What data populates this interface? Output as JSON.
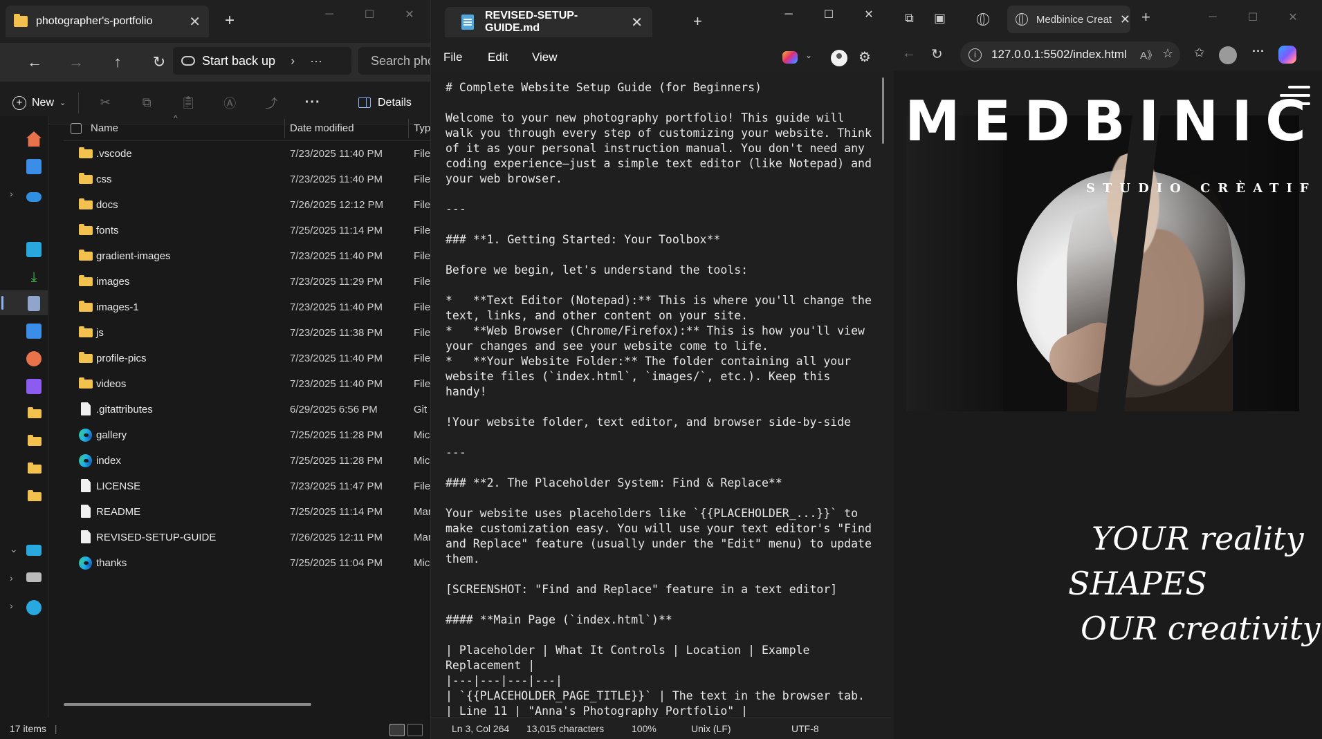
{
  "explorer": {
    "tab_title": "photographer's-portfolio",
    "address": "Start back up",
    "search_placeholder": "Search pho",
    "new_label": "New",
    "details_label": "Details",
    "columns": {
      "name": "Name",
      "date": "Date modified",
      "type": "Typ"
    },
    "rows": [
      {
        "name": ".vscode",
        "date": "7/23/2025 11:40 PM",
        "type": "File",
        "icon": "folder"
      },
      {
        "name": "css",
        "date": "7/23/2025 11:40 PM",
        "type": "File",
        "icon": "folder"
      },
      {
        "name": "docs",
        "date": "7/26/2025 12:12 PM",
        "type": "File",
        "icon": "folder"
      },
      {
        "name": "fonts",
        "date": "7/25/2025 11:14 PM",
        "type": "File",
        "icon": "folder"
      },
      {
        "name": "gradient-images",
        "date": "7/23/2025 11:40 PM",
        "type": "File",
        "icon": "folder"
      },
      {
        "name": "images",
        "date": "7/23/2025 11:29 PM",
        "type": "File",
        "icon": "folder"
      },
      {
        "name": "images-1",
        "date": "7/23/2025 11:40 PM",
        "type": "File",
        "icon": "folder"
      },
      {
        "name": "js",
        "date": "7/23/2025 11:38 PM",
        "type": "File",
        "icon": "folder"
      },
      {
        "name": "profile-pics",
        "date": "7/23/2025 11:40 PM",
        "type": "File",
        "icon": "folder"
      },
      {
        "name": "videos",
        "date": "7/23/2025 11:40 PM",
        "type": "File",
        "icon": "folder"
      },
      {
        "name": ".gitattributes",
        "date": "6/29/2025 6:56 PM",
        "type": "Git",
        "icon": "document"
      },
      {
        "name": "gallery",
        "date": "7/25/2025 11:28 PM",
        "type": "Mic",
        "icon": "edge"
      },
      {
        "name": "index",
        "date": "7/25/2025 11:28 PM",
        "type": "Mic",
        "icon": "edge"
      },
      {
        "name": "LICENSE",
        "date": "7/23/2025 11:47 PM",
        "type": "File",
        "icon": "document"
      },
      {
        "name": "README",
        "date": "7/25/2025 11:14 PM",
        "type": "Mar",
        "icon": "document"
      },
      {
        "name": "REVISED-SETUP-GUIDE",
        "date": "7/26/2025 12:11 PM",
        "type": "Mar",
        "icon": "document"
      },
      {
        "name": "thanks",
        "date": "7/25/2025 11:04 PM",
        "type": "Mic",
        "icon": "edge"
      }
    ],
    "status": "17 items",
    "status_sep": "|"
  },
  "notepad": {
    "tab_title": "REVISED-SETUP-GUIDE.md",
    "menu": [
      "File",
      "Edit",
      "View"
    ],
    "content": "# Complete Website Setup Guide (for Beginners)\n\nWelcome to your new photography portfolio! This guide will\nwalk you through every step of customizing your website. Think\nof it as your personal instruction manual. You don't need any\ncoding experience—just a simple text editor (like Notepad) and\nyour web browser.\n\n---\n\n### **1. Getting Started: Your Toolbox**\n\nBefore we begin, let's understand the tools:\n\n*   **Text Editor (Notepad):** This is where you'll change the\ntext, links, and other content on your site.\n*   **Web Browser (Chrome/Firefox):** This is how you'll view\nyour changes and see your website come to life.\n*   **Your Website Folder:** The folder containing all your\nwebsite files (`index.html`, `images/`, etc.). Keep this\nhandy!\n\n!Your website folder, text editor, and browser side-by-side\n\n---\n\n### **2. The Placeholder System: Find & Replace**\n\nYour website uses placeholders like `{{PLACEHOLDER_...}}` to\nmake customization easy. You will use your text editor's \"Find\nand Replace\" feature (usually under the \"Edit\" menu) to update\nthem.\n\n[SCREENSHOT: \"Find and Replace\" feature in a text editor]\n\n#### **Main Page (`index.html`)**\n\n| Placeholder | What It Controls | Location | Example\nReplacement |\n|---|---|---|---|\n| `{{PLACEHOLDER_PAGE_TITLE}}` | The text in the browser tab.\n| Line 11 | \"Anna's Photography Portfolio\" |",
    "status": {
      "position": "Ln 3, Col 264",
      "chars": "13,015 characters",
      "zoom": "100%",
      "eol": "Unix (LF)",
      "encoding": "UTF-8"
    }
  },
  "browser": {
    "tab_title": "Medbinice Creat",
    "url": "127.0.0.1:5502/index.html",
    "site": {
      "brand": "MEDBINICE",
      "sub_brand": "STUDIO CRÈATIF",
      "tagline": [
        "YOUR reality",
        "SHAPES",
        "OUR creativity"
      ]
    }
  },
  "colors": {
    "accent": "#8ab4f8",
    "folder": "#f2c14e",
    "bg_dark": "#191919"
  }
}
